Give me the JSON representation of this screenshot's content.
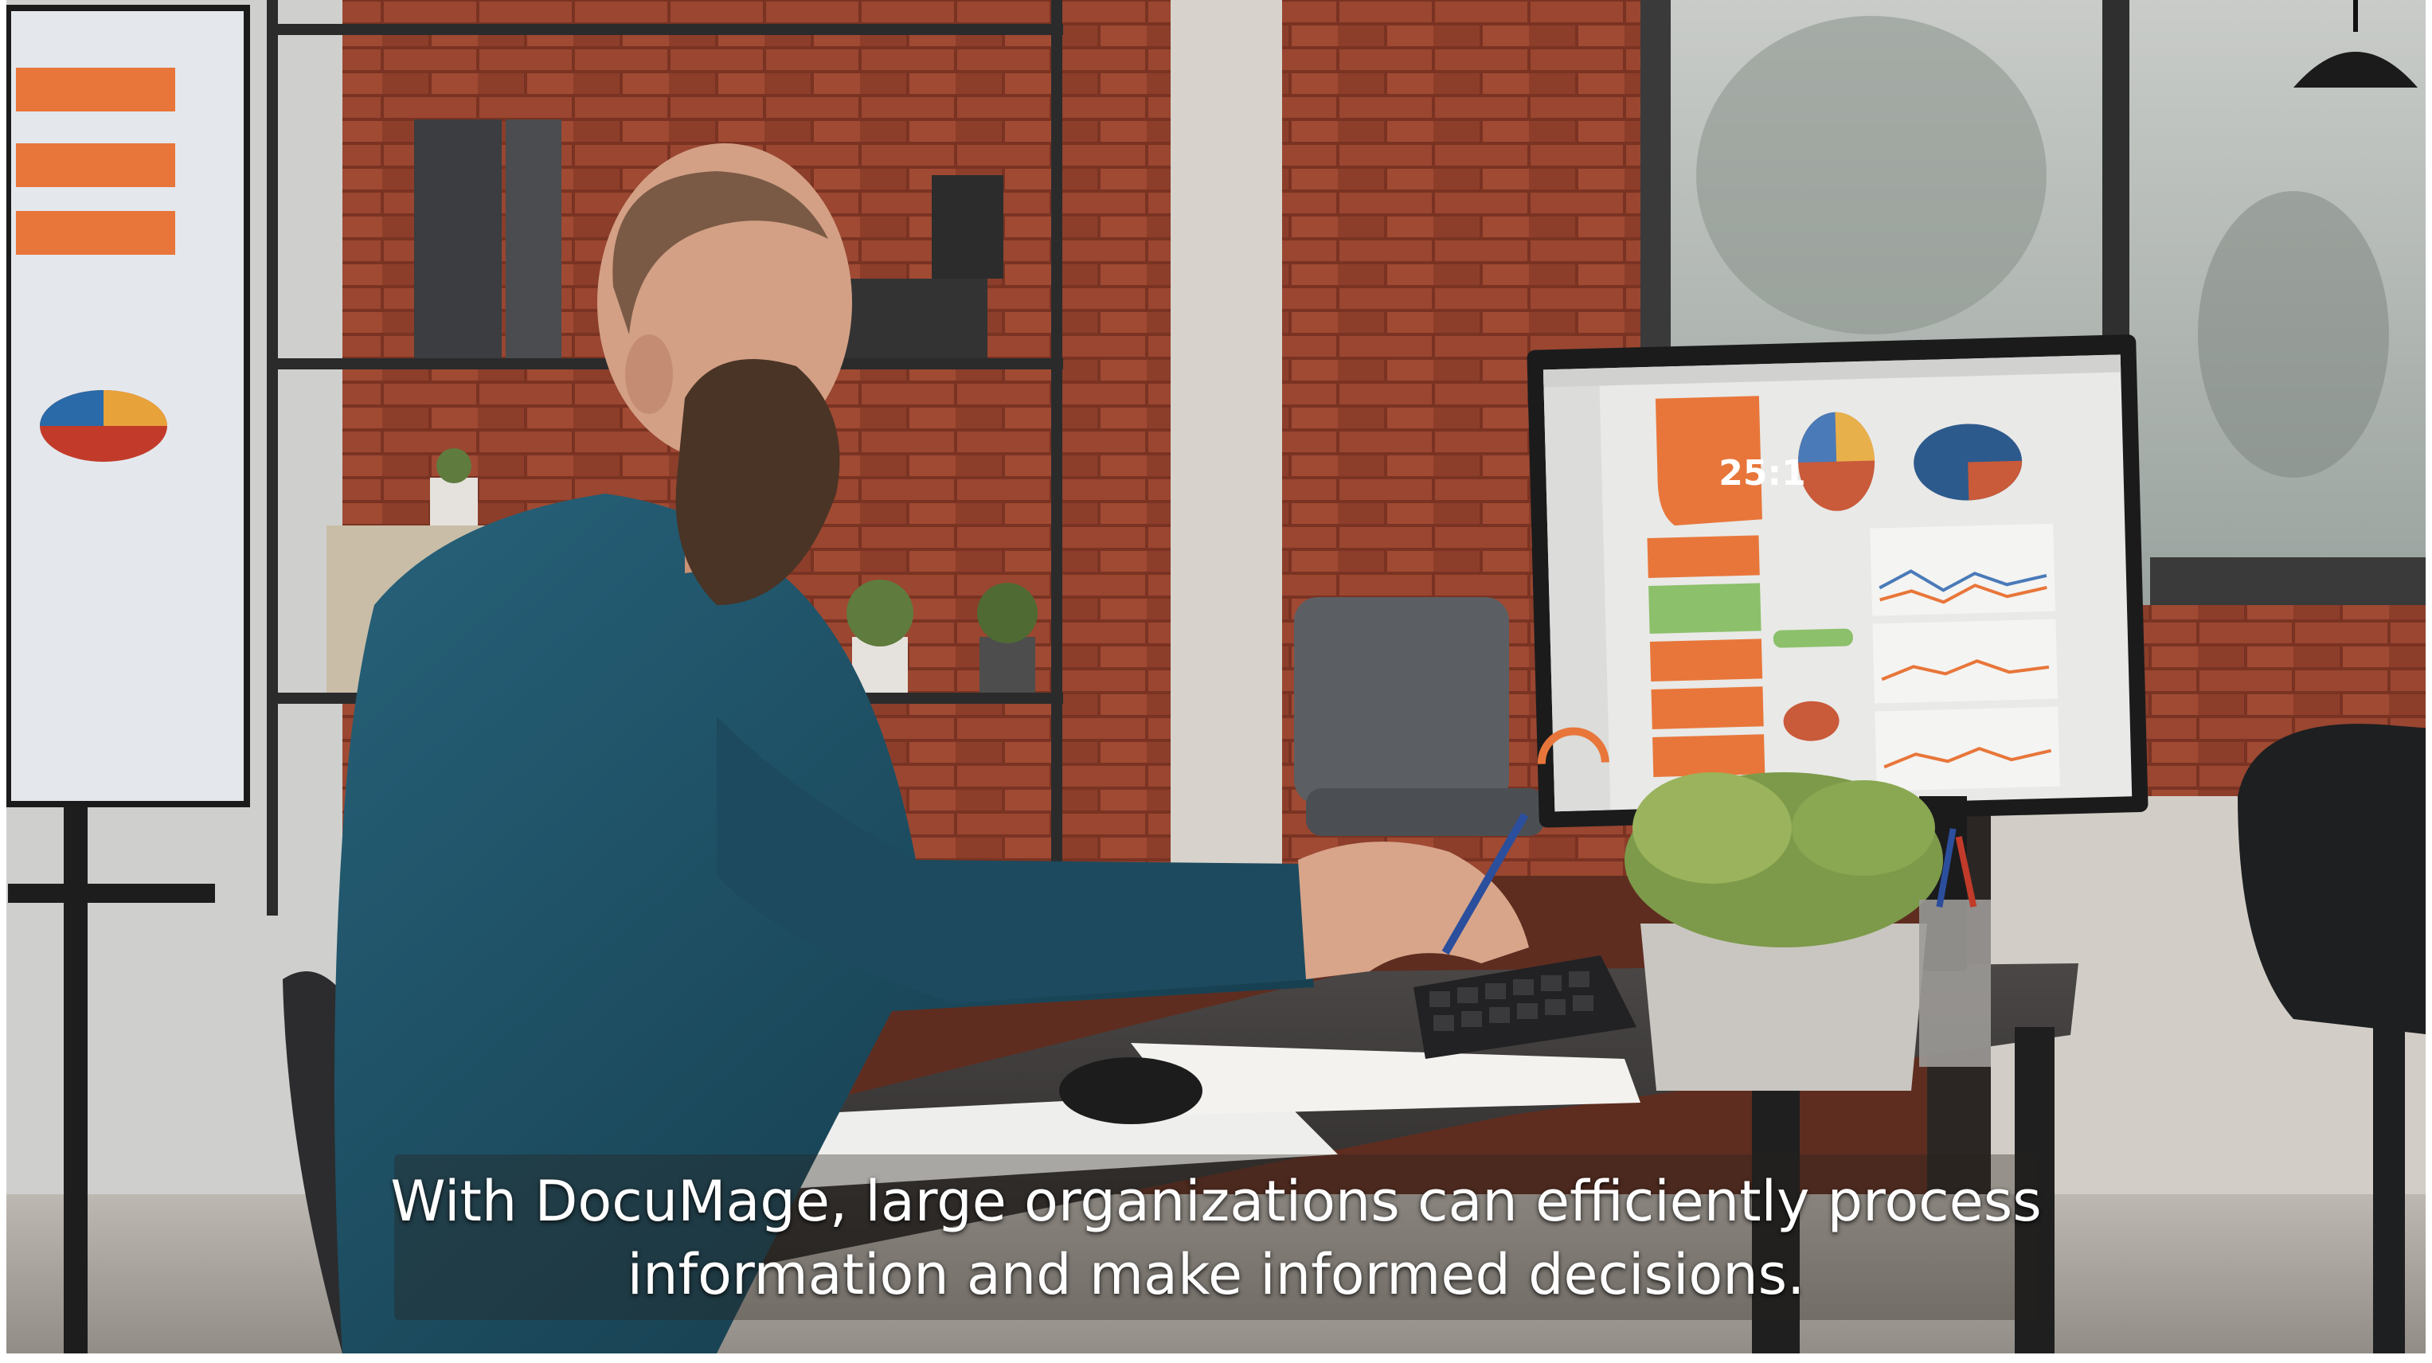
{
  "subtitle": {
    "line1": "With DocuMage, large organizations can efficiently process",
    "line2": "information and make informed decisions."
  },
  "monitor": {
    "ratio_text": "25:1"
  },
  "colors": {
    "brick": "#8a3b26",
    "shirt": "#1f4f63",
    "desk": "#3a3838",
    "accent_orange": "#e8763a"
  }
}
